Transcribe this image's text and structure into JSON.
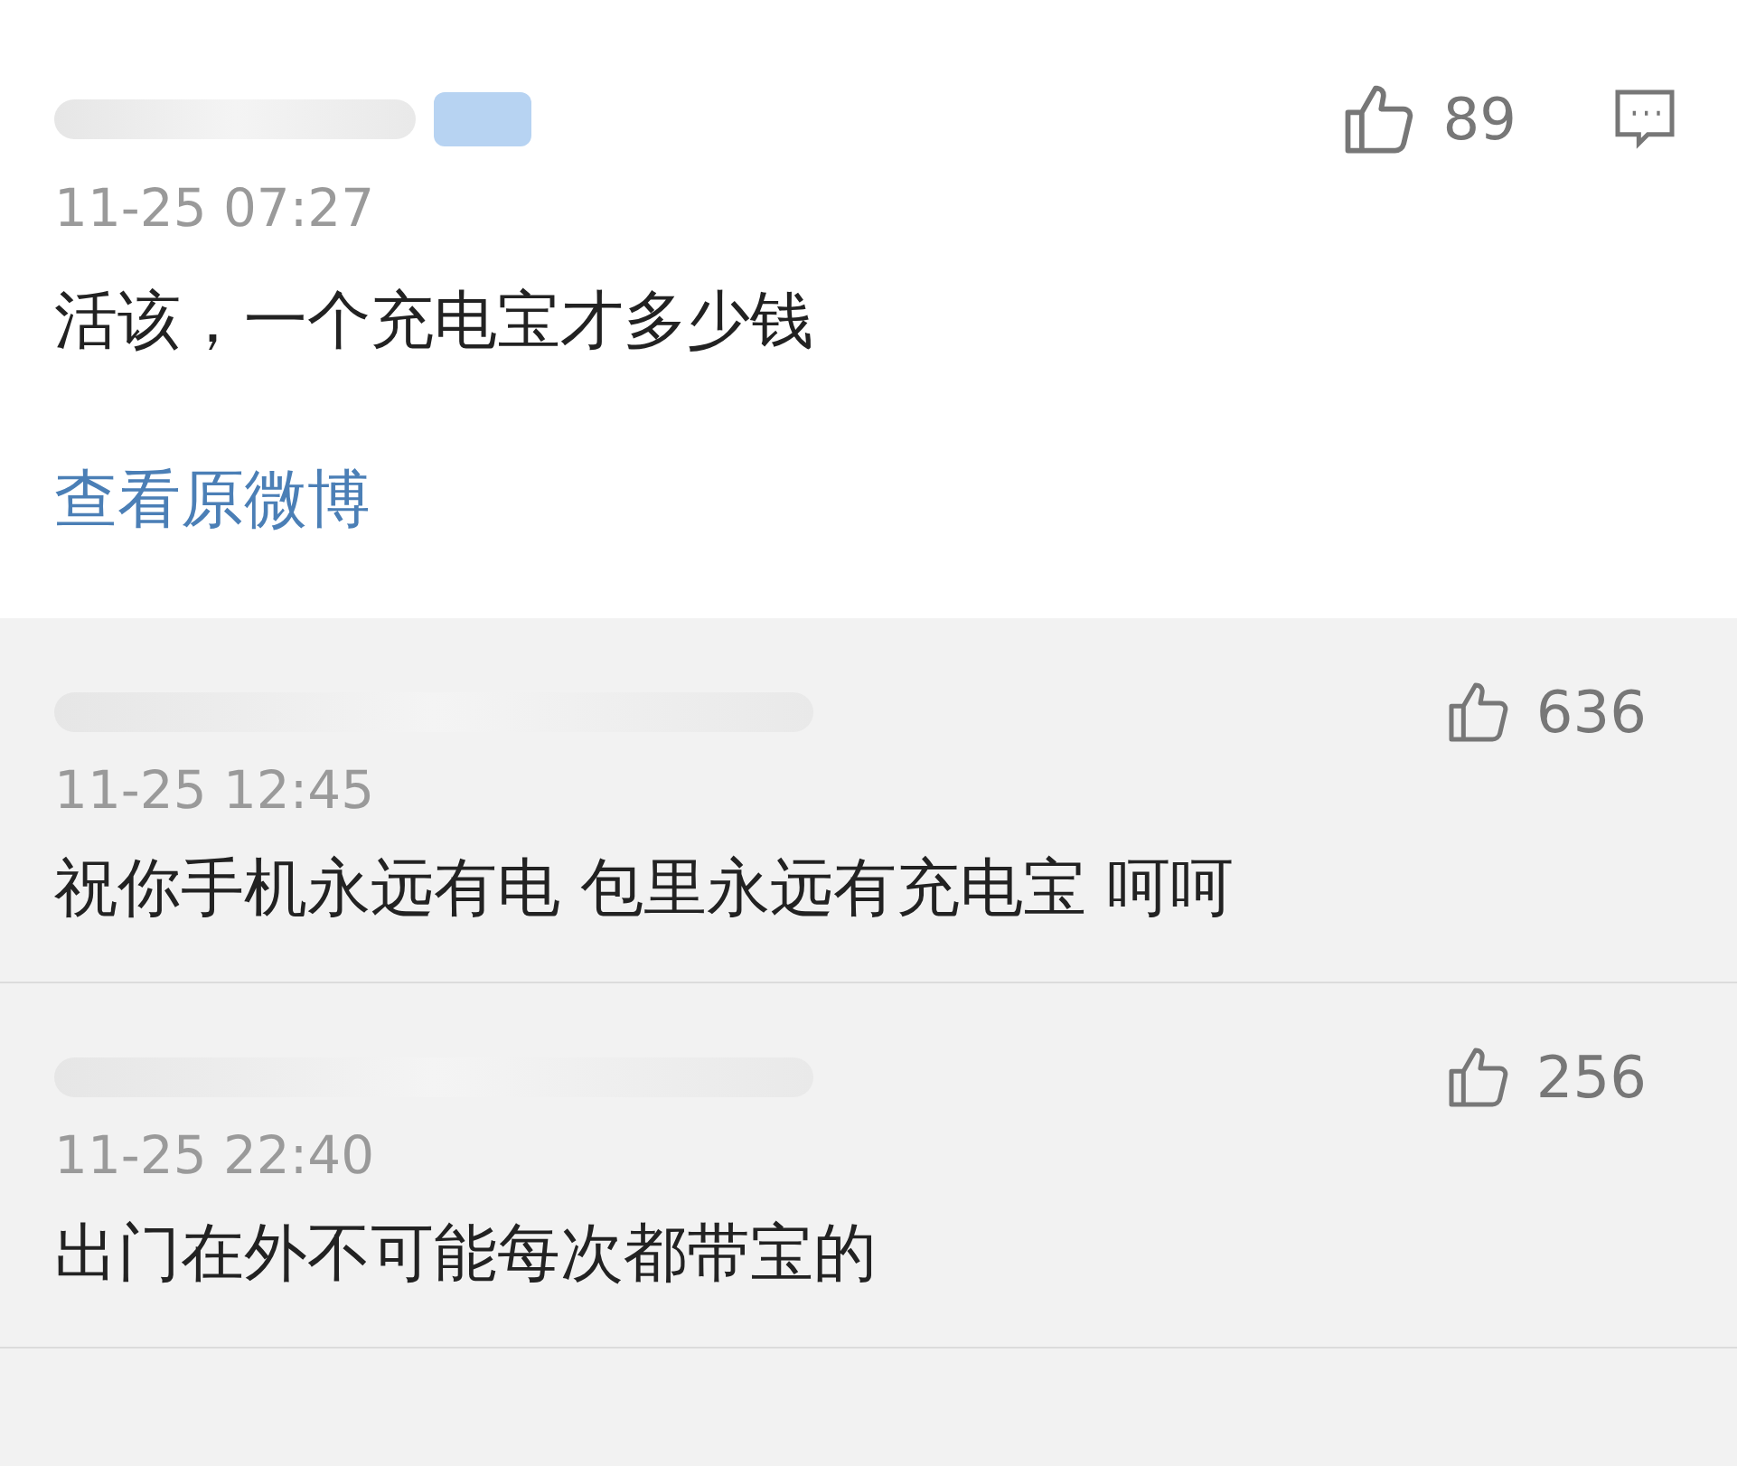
{
  "post": {
    "time": "11-25 07:27",
    "likes": "89",
    "text": "活该，一个充电宝才多少钱",
    "link": "查看原微博"
  },
  "replies": [
    {
      "time": "11-25 12:45",
      "likes": "636",
      "text": "祝你手机永远有电 包里永远有充电宝 呵呵"
    },
    {
      "time": "11-25 22:40",
      "likes": "256",
      "text": "出门在外不可能每次都带宝的"
    }
  ]
}
